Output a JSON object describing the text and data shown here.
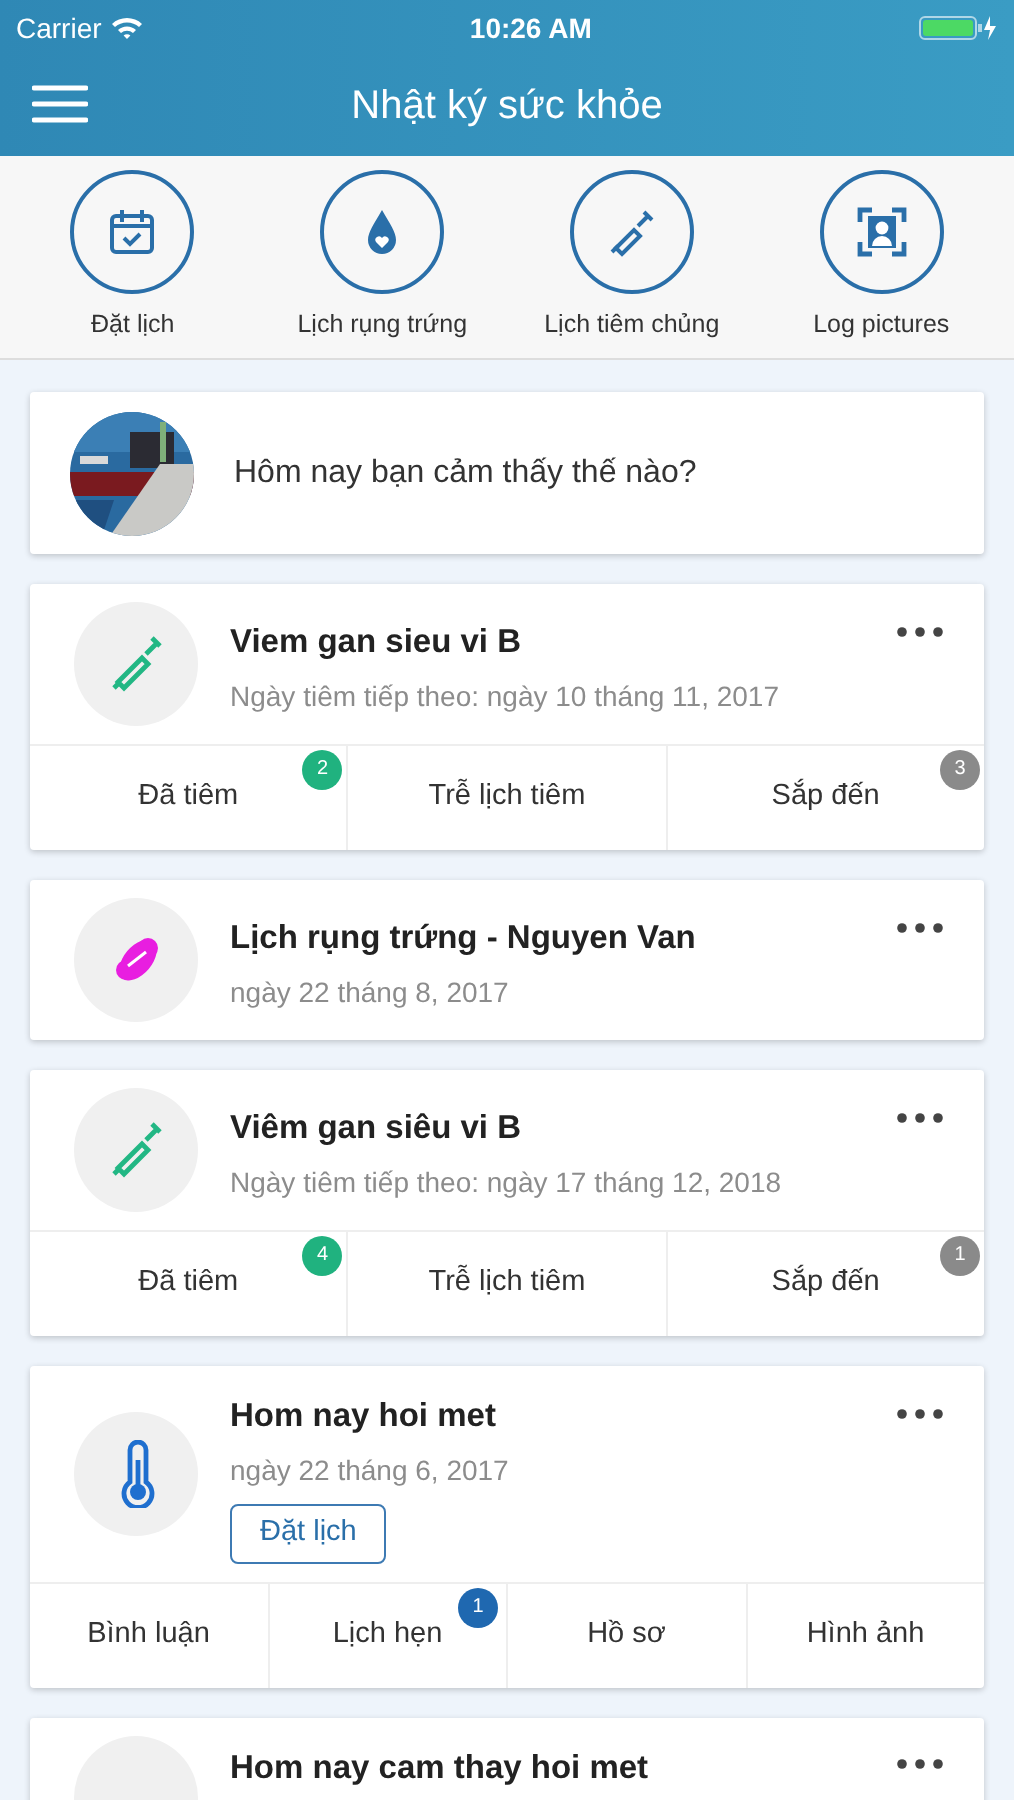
{
  "status_bar": {
    "carrier": "Carrier",
    "time": "10:26 AM"
  },
  "header": {
    "title": "Nhật ký sức khỏe"
  },
  "shortcuts": [
    {
      "kind": "calendar",
      "label": "Đặt lịch"
    },
    {
      "kind": "drop",
      "label": "Lịch rụng trứng"
    },
    {
      "kind": "syringe",
      "label": "Lịch tiêm chủng"
    },
    {
      "label": "Log pictures"
    }
  ],
  "prompt": {
    "text": "Hôm nay bạn cảm thấy thế nào?"
  },
  "entries": [
    {
      "kind": "syringe",
      "title": "Viem gan sieu vi B",
      "subtitle": "Ngày tiêm tiếp theo: ngày 10 tháng 11, 2017",
      "actions": [
        {
          "label": "Đã tiêm",
          "badge": "2",
          "color": "#20b27f"
        },
        {
          "label": "Trễ lịch tiêm"
        },
        {
          "label": "Sắp đến",
          "badge": "3",
          "color": "#8a8a8a"
        }
      ]
    },
    {
      "kind": "pad",
      "title": "Lịch rụng trứng - Nguyen Van",
      "subtitle": "ngày 22 tháng 8, 2017"
    },
    {
      "kind": "syringe",
      "title": "Viêm gan siêu vi B",
      "subtitle": "Ngày tiêm tiếp theo: ngày 17 tháng 12, 2018",
      "actions": [
        {
          "label": "Đã tiêm",
          "badge": "4",
          "color": "#20b27f"
        },
        {
          "label": "Trễ lịch tiêm"
        },
        {
          "label": "Sắp đến",
          "badge": "1",
          "color": "#8a8a8a"
        }
      ]
    },
    {
      "kind": "thermometer",
      "title": "Hom nay hoi met",
      "subtitle": "ngày 22 tháng 6, 2017",
      "button": "Đặt lịch",
      "actions": [
        {
          "label": "Bình luận"
        },
        {
          "label": "Lịch hẹn",
          "badge": "1",
          "color": "#1f68b0"
        },
        {
          "label": "Hồ sơ"
        },
        {
          "label": "Hình ảnh"
        }
      ]
    },
    {
      "kind": "symptom",
      "title": "Hom nay cam thay hoi met"
    }
  ]
}
